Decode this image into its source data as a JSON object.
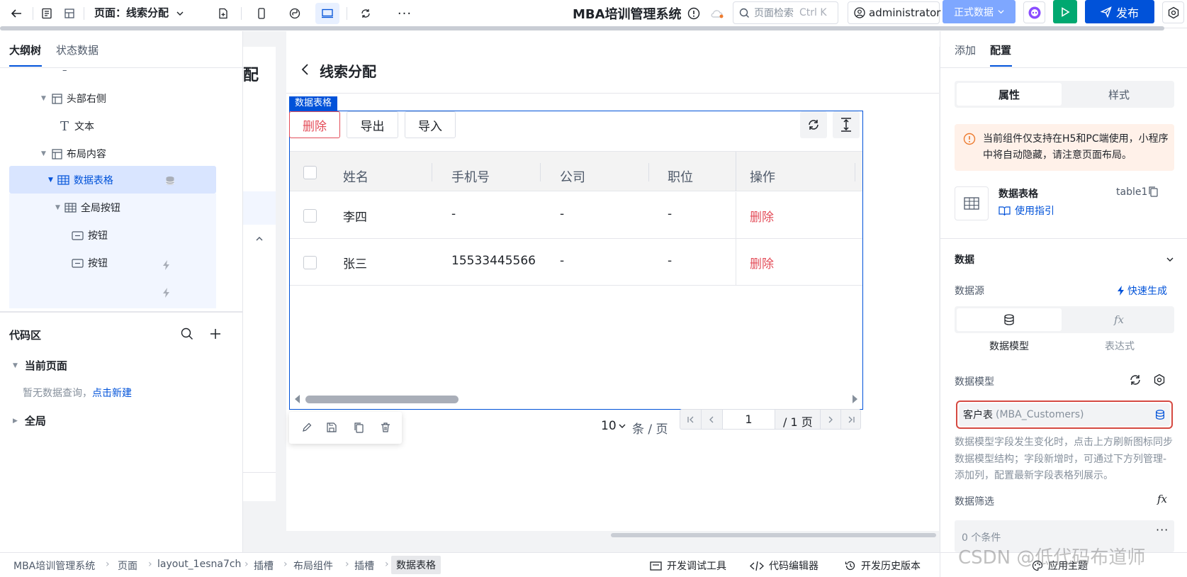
{
  "topbar": {
    "page_label": "页面：线索分配",
    "app_title": "MBA培训管理系统",
    "search_placeholder": "页面检索",
    "search_shortcut": "Ctrl K",
    "user": "administrator",
    "env_label": "正式数据",
    "publish_label": "发布"
  },
  "left": {
    "tabs": [
      "大纲树",
      "状态数据"
    ],
    "tree_dash": "–",
    "tree": [
      {
        "label": "头部右侧"
      },
      {
        "label": "文本"
      },
      {
        "label": "布局内容"
      },
      {
        "label": "数据表格"
      },
      {
        "label": "全局按钮"
      },
      {
        "label": "按钮"
      },
      {
        "label": "按钮"
      }
    ],
    "code_title": "代码区",
    "current_page": "当前页面",
    "no_query": "暂无数据查询，",
    "new_link": "点击新建",
    "global": "全局"
  },
  "canvas": {
    "back_title": "线索分配",
    "partial_text": "配",
    "component_tag": "数据表格",
    "buttons": {
      "delete": "删除",
      "export": "导出",
      "import": "导入"
    },
    "columns": [
      "姓名",
      "手机号",
      "公司",
      "职位",
      "操作"
    ],
    "rows": [
      {
        "name": "李四",
        "phone": "-",
        "company": "-",
        "position": "-",
        "action": "删除"
      },
      {
        "name": "张三",
        "phone": "15533445566",
        "company": "-",
        "position": "-",
        "action": "删除"
      }
    ],
    "pagination": {
      "page_size": "10",
      "per_page": "条 / 页",
      "page": "1",
      "total_pages": "/ 1 页"
    }
  },
  "right": {
    "tabs": [
      "添加",
      "配置"
    ],
    "sub_tabs": [
      "属性",
      "样式"
    ],
    "notice": "当前组件仅支持在H5和PC端使用，小程序中将自动隐藏，请注意页面布局。",
    "component_name": "数据表格",
    "component_id": "table1",
    "guide": "使用指引",
    "section_data": "数据",
    "datasource_label": "数据源",
    "quick_gen": "快速生成",
    "ds_options": [
      "数据模型",
      "表达式"
    ],
    "model_label": "数据模型",
    "model_value": "客户表",
    "model_code": "(MBA_Customers)",
    "model_hint": "数据模型字段发生变化时，点击上方刷新图标同步数据模型结构；字段新增时，可通过下方列管理-添加列，配置最新字段表格列展示。",
    "filter_label": "数据筛选",
    "filter_value": "0 个条件"
  },
  "bottom": {
    "breadcrumbs": [
      "MBA培训管理系统",
      "页面",
      "layout_1esna7ch",
      "插槽",
      "布局组件",
      "插槽",
      "数据表格"
    ],
    "tools": [
      "开发调试工具",
      "代码编辑器",
      "开发历史版本",
      "应用主题"
    ],
    "watermark": "CSDN @低代码布道师"
  },
  "colors": {
    "primary": "#0052d9",
    "danger": "#e34d59",
    "green": "#00a870",
    "highlight_border": "#d54941"
  }
}
